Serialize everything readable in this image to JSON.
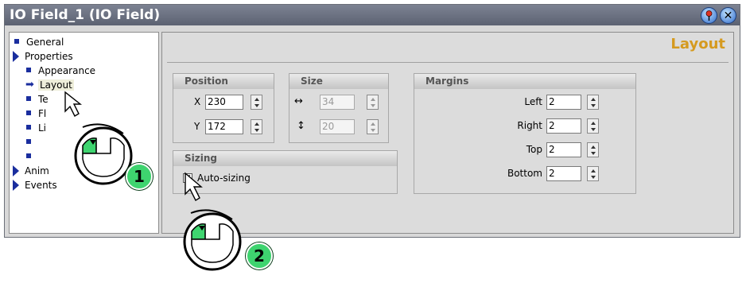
{
  "window": {
    "title": "IO Field_1 (IO Field)",
    "pin_icon": "pin-icon",
    "close_icon": "close-icon"
  },
  "tree": {
    "items": [
      {
        "label": "General",
        "marker": "square"
      },
      {
        "label": "Properties",
        "marker": "triangle"
      },
      {
        "label": "Appearance",
        "marker": "square"
      },
      {
        "label": "Layout",
        "marker": "arrow",
        "selected": true
      },
      {
        "label": "Te",
        "marker": "square"
      },
      {
        "label": "Fl",
        "marker": "square"
      },
      {
        "label": "Li",
        "marker": "square"
      },
      {
        "label": "",
        "marker": "square"
      },
      {
        "label": "",
        "marker": "square"
      },
      {
        "label": "Anim",
        "marker": "triangle"
      },
      {
        "label": "Events",
        "marker": "triangle"
      }
    ]
  },
  "panel": {
    "heading": "Layout",
    "position": {
      "title": "Position",
      "x_label": "X",
      "x_value": "230",
      "y_label": "Y",
      "y_value": "172"
    },
    "size": {
      "title": "Size",
      "width_value": "34",
      "height_value": "20"
    },
    "margins": {
      "title": "Margins",
      "left_label": "Left",
      "left_value": "2",
      "right_label": "Right",
      "right_value": "2",
      "top_label": "Top",
      "top_value": "2",
      "bottom_label": "Bottom",
      "bottom_value": "2"
    },
    "sizing": {
      "title": "Sizing",
      "auto_label": "Auto-sizing",
      "auto_checked": true
    }
  },
  "callouts": {
    "step1": "1",
    "step2": "2"
  },
  "colors": {
    "title_bar": "#6a7080",
    "heading": "#d59a1f",
    "callout": "#3ed46f",
    "tree_marker": "#1a2e9e"
  }
}
